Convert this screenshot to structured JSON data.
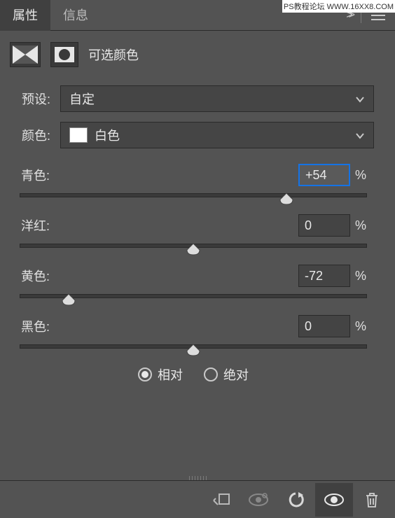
{
  "watermark": "PS教程论坛 WWW.16XX8.COM",
  "header": {
    "tab_properties": "属性",
    "tab_info": "信息"
  },
  "subheader": {
    "title": "可选颜色"
  },
  "preset": {
    "label": "预设:",
    "value": "自定"
  },
  "color": {
    "label": "颜色:",
    "value": "白色",
    "swatch": "#ffffff"
  },
  "sliders": {
    "cyan": {
      "label": "青色:",
      "value": "+54",
      "pos": 77,
      "highlight": true
    },
    "magenta": {
      "label": "洋红:",
      "value": "0",
      "pos": 50,
      "highlight": false
    },
    "yellow": {
      "label": "黄色:",
      "value": "-72",
      "pos": 14,
      "highlight": false
    },
    "black": {
      "label": "黑色:",
      "value": "0",
      "pos": 50,
      "highlight": false
    }
  },
  "percent": "%",
  "mode": {
    "relative": "相对",
    "absolute": "绝对",
    "selected": "relative"
  },
  "chart_data": {
    "type": "table",
    "title": "可选颜色",
    "categories": [
      "青色",
      "洋红",
      "黄色",
      "黑色"
    ],
    "values": [
      54,
      0,
      -72,
      0
    ],
    "unit": "%",
    "range": [
      -100,
      100
    ]
  }
}
